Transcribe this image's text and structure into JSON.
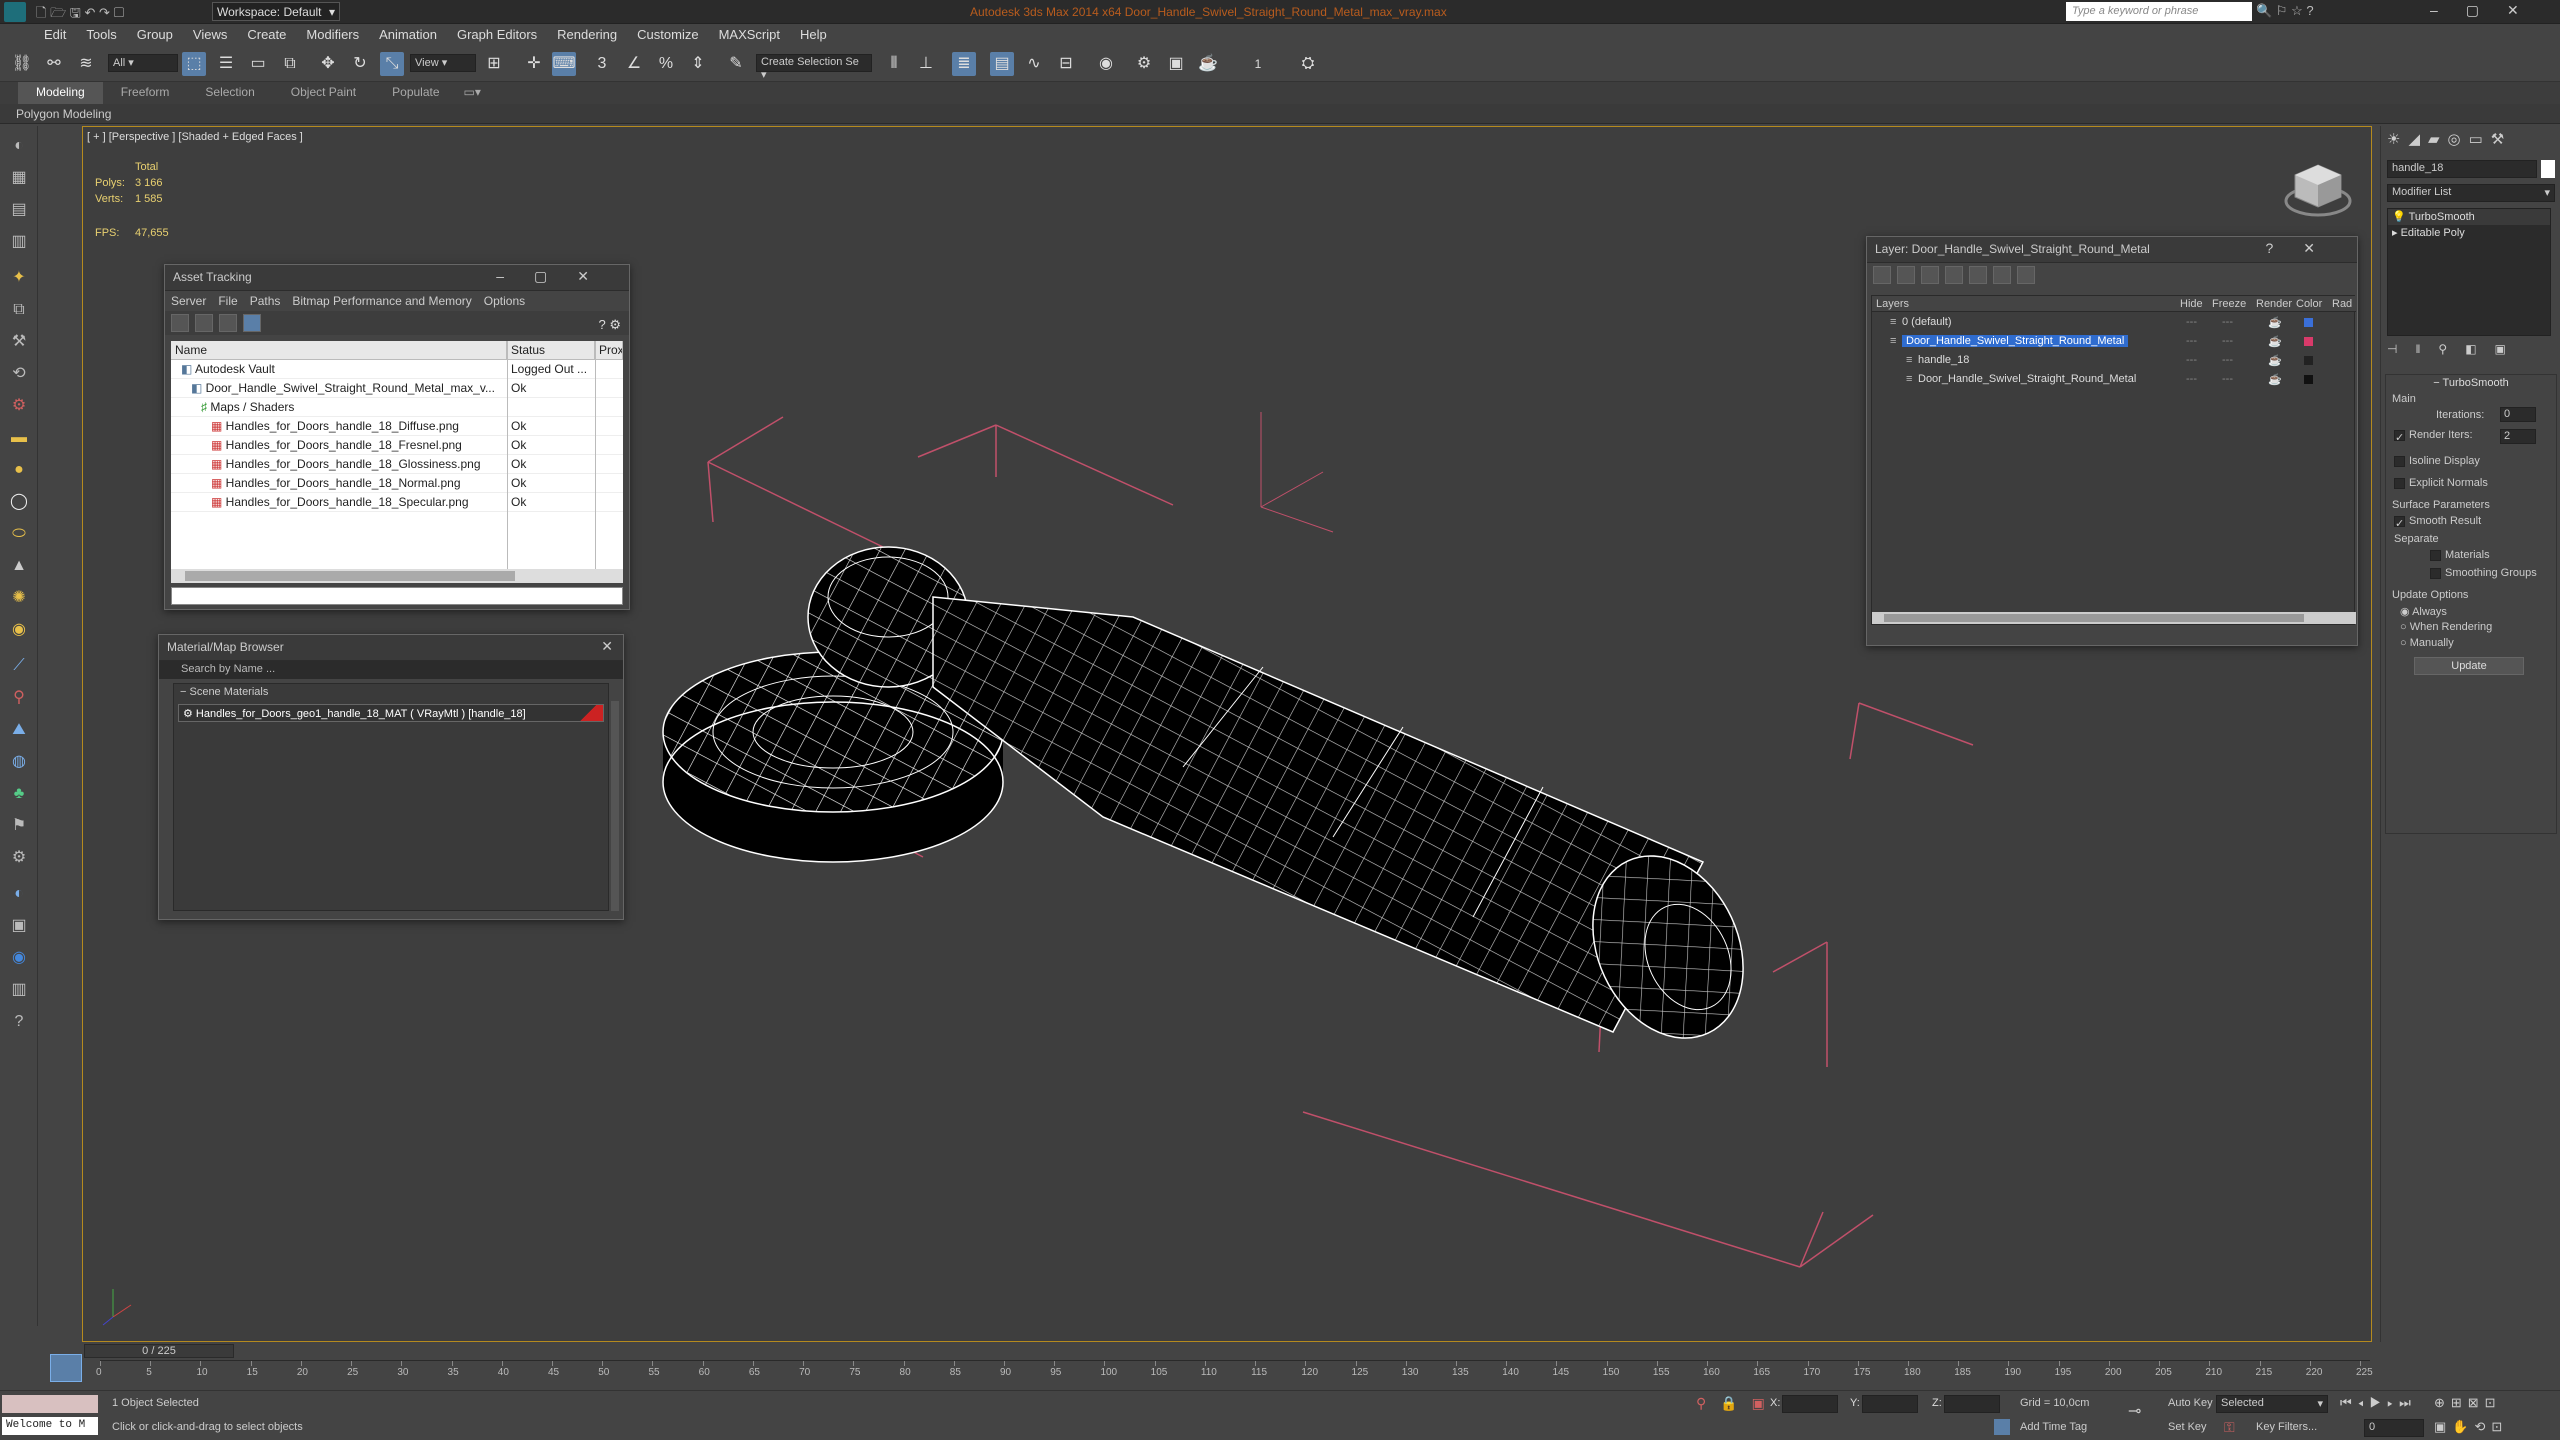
{
  "app": {
    "workspace": "Workspace: Default",
    "title": "Autodesk 3ds Max 2014 x64    Door_Handle_Swivel_Straight_Round_Metal_max_vray.max",
    "search_placeholder": "Type a keyword or phrase"
  },
  "menu": [
    "Edit",
    "Tools",
    "Group",
    "Views",
    "Create",
    "Modifiers",
    "Animation",
    "Graph Editors",
    "Rendering",
    "Customize",
    "MAXScript",
    "Help"
  ],
  "toolbar": {
    "filter": "All",
    "view": "View",
    "selection_set": "Create Selection Se",
    "number": "1"
  },
  "ribbon": {
    "tabs": [
      "Modeling",
      "Freeform",
      "Selection",
      "Object Paint",
      "Populate"
    ],
    "sub": "Polygon Modeling"
  },
  "viewport": {
    "label": "[ + ] [Perspective ] [Shaded + Edged Faces ]",
    "stats_total": "Total",
    "polys_label": "Polys:",
    "polys_value": "3 166",
    "verts_label": "Verts:",
    "verts_value": "1 585",
    "fps_label": "FPS:",
    "fps_value": "47,655"
  },
  "asset_tracking": {
    "title": "Asset Tracking",
    "menu": [
      "Server",
      "File",
      "Paths",
      "Bitmap Performance and Memory",
      "Options"
    ],
    "columns": [
      "Name",
      "Status",
      "Proxy"
    ],
    "rows": [
      {
        "name": "Autodesk Vault",
        "status": "Logged Out ...",
        "indent": 1
      },
      {
        "name": "Door_Handle_Swivel_Straight_Round_Metal_max_v...",
        "status": "Ok",
        "indent": 2
      },
      {
        "name": "Maps / Shaders",
        "status": "",
        "indent": 3
      },
      {
        "name": "Handles_for_Doors_handle_18_Diffuse.png",
        "status": "Ok",
        "indent": 4
      },
      {
        "name": "Handles_for_Doors_handle_18_Fresnel.png",
        "status": "Ok",
        "indent": 4
      },
      {
        "name": "Handles_for_Doors_handle_18_Glossiness.png",
        "status": "Ok",
        "indent": 4
      },
      {
        "name": "Handles_for_Doors_handle_18_Normal.png",
        "status": "Ok",
        "indent": 4
      },
      {
        "name": "Handles_for_Doors_handle_18_Specular.png",
        "status": "Ok",
        "indent": 4
      }
    ]
  },
  "material_browser": {
    "title": "Material/Map Browser",
    "search": "Search by Name ...",
    "section": "Scene Materials",
    "item": "Handles_for_Doors_geo1_handle_18_MAT ( VRayMtl ) [handle_18]"
  },
  "layer_window": {
    "title": "Layer: Door_Handle_Swivel_Straight_Round_Metal",
    "columns": [
      "Layers",
      "Hide",
      "Freeze",
      "Render",
      "Color",
      "Rad"
    ],
    "rows": [
      {
        "name": "0 (default)",
        "selected": false,
        "color": "#3a6fd8"
      },
      {
        "name": "Door_Handle_Swivel_Straight_Round_Metal",
        "selected": true,
        "color": "#d83a6a"
      },
      {
        "name": "handle_18",
        "selected": false,
        "color": "#222222"
      },
      {
        "name": "Door_Handle_Swivel_Straight_Round_Metal",
        "selected": false,
        "color": "#111111"
      }
    ]
  },
  "command_panel": {
    "object_name": "handle_18",
    "modifier_list": "Modifier List",
    "stack": [
      "TurboSmooth",
      "Editable Poly"
    ],
    "rollout_title": "TurboSmooth",
    "main": "Main",
    "iterations_label": "Iterations:",
    "iterations": "0",
    "render_iters_label": "Render Iters:",
    "render_iters": "2",
    "isoline": "Isoline Display",
    "explicit": "Explicit Normals",
    "surface_params": "Surface Parameters",
    "smooth_result": "Smooth Result",
    "separate": "Separate",
    "materials": "Materials",
    "smoothing_groups": "Smoothing Groups",
    "update_options": "Update Options",
    "always": "Always",
    "when_rendering": "When Rendering",
    "manually": "Manually",
    "update_btn": "Update"
  },
  "timeline": {
    "frame": "0 / 225",
    "ticks": [
      "0",
      "5",
      "10",
      "15",
      "20",
      "25",
      "30",
      "35",
      "40",
      "45",
      "50",
      "55",
      "60",
      "65",
      "70",
      "75",
      "80",
      "85",
      "90",
      "95",
      "100",
      "105",
      "110",
      "115",
      "120",
      "125",
      "130",
      "135",
      "140",
      "145",
      "150",
      "155",
      "160",
      "165",
      "170",
      "175",
      "180",
      "185",
      "190",
      "195",
      "200",
      "205",
      "210",
      "215",
      "220",
      "225"
    ]
  },
  "status": {
    "welcome": "Welcome to M",
    "selected": "1 Object Selected",
    "hint": "Click or click-and-drag to select objects",
    "x_label": "X:",
    "y_label": "Y:",
    "z_label": "Z:",
    "grid": "Grid = 10,0cm",
    "add_time_tag": "Add Time Tag",
    "auto_key": "Auto Key",
    "set_key": "Set Key",
    "key_mode": "Selected",
    "key_filters": "Key Filters...",
    "frame_field": "0"
  },
  "colors": {
    "accent": "#5a7fa8",
    "viewport_border": "#b58a1e",
    "bbox": "#c0506a"
  }
}
